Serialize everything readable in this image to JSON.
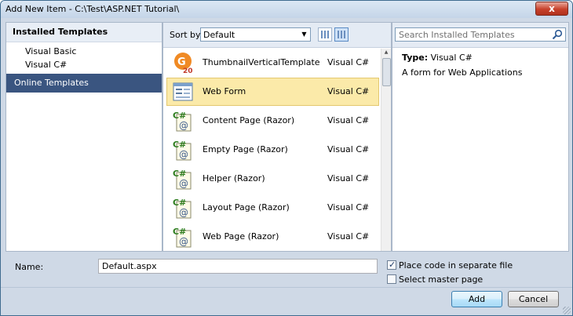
{
  "window": {
    "title": "Add New Item - C:\\Test\\ASP.NET Tutorial\\",
    "close_label": "x"
  },
  "left_panel": {
    "installed_templates": "Installed Templates",
    "sub_items": [
      "Visual Basic",
      "Visual C#"
    ],
    "online_templates": "Online Templates"
  },
  "toolbar": {
    "sort_by_label": "Sort by:",
    "sort_value": "Default"
  },
  "search": {
    "placeholder": "Search Installed Templates"
  },
  "templates": [
    {
      "name": "ThumbnailVerticalTemplate",
      "type": "Visual C#",
      "icon": "ig20-icon"
    },
    {
      "name": "Web Form",
      "type": "Visual C#",
      "icon": "web-form-icon"
    },
    {
      "name": "Content Page (Razor)",
      "type": "Visual C#",
      "icon": "csharp-razor-icon"
    },
    {
      "name": "Empty Page (Razor)",
      "type": "Visual C#",
      "icon": "csharp-razor-icon"
    },
    {
      "name": "Helper (Razor)",
      "type": "Visual C#",
      "icon": "csharp-razor-icon"
    },
    {
      "name": "Layout Page (Razor)",
      "type": "Visual C#",
      "icon": "csharp-razor-icon"
    },
    {
      "name": "Web Page (Razor)",
      "type": "Visual C#",
      "icon": "csharp-razor-icon"
    }
  ],
  "details": {
    "type_label": "Type:",
    "type_value": "Visual C#",
    "description": "A form for Web Applications"
  },
  "bottom": {
    "name_label": "Name:",
    "name_value": "Default.aspx",
    "place_code_label": "Place code in separate file",
    "place_code_checked": true,
    "select_master_label": "Select master page",
    "select_master_checked": false,
    "add_label": "Add",
    "cancel_label": "Cancel"
  }
}
